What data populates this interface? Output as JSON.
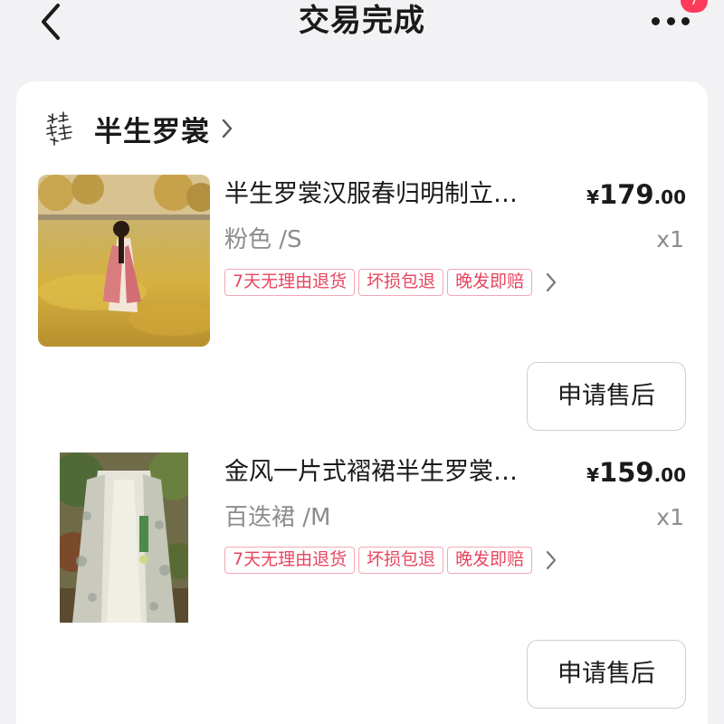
{
  "header": {
    "title": "交易完成",
    "badge": "7"
  },
  "shop": {
    "name": "半生罗裳"
  },
  "items": [
    {
      "title": "半生罗裳汉服春归明制立…",
      "price_currency": "¥",
      "price_int": "179",
      "price_dec": ".00",
      "spec": "粉色 /S",
      "qty": "x1",
      "tags": [
        "7天无理由退货",
        "坏损包退",
        "晚发即赔"
      ],
      "action_label": "申请售后"
    },
    {
      "title": "金风一片式褶裙半生罗裳…",
      "price_currency": "¥",
      "price_int": "159",
      "price_dec": ".00",
      "spec": "百迭裙 /M",
      "qty": "x1",
      "tags": [
        "7天无理由退货",
        "坏损包退",
        "晚发即赔"
      ],
      "action_label": "申请售后"
    }
  ],
  "colors": {
    "page_background": "#f2f2f4",
    "card_background": "#ffffff",
    "tag_text": "#e8455f",
    "tag_border": "#f0a8b4",
    "badge": "#ff3b5c"
  },
  "icons": [
    "back-arrow-icon",
    "more-dots-icon",
    "shop-logo-icon",
    "chevron-right-icon"
  ]
}
